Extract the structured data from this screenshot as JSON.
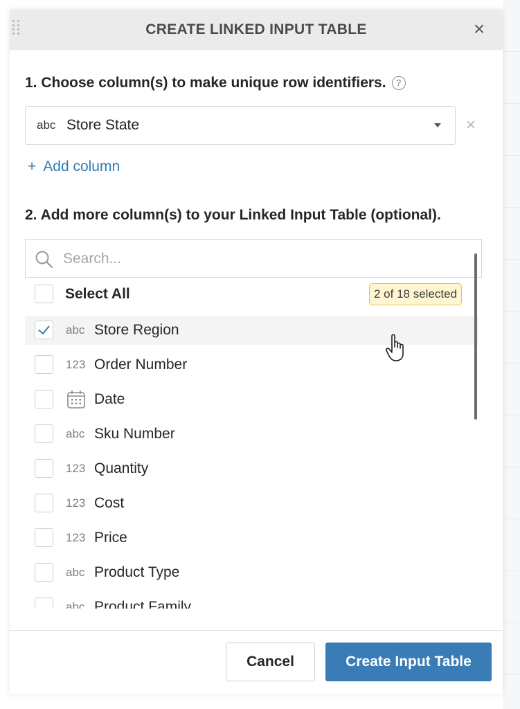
{
  "dialog": {
    "title": "CREATE LINKED INPUT TABLE",
    "close_label": "×"
  },
  "section1": {
    "label": "1. Choose column(s) to make unique row identifiers.",
    "help_label": "?",
    "selected_column": {
      "type": "abc",
      "name": "Store State"
    },
    "remove_label": "×",
    "add_column_plus": "+",
    "add_column_label": "Add column"
  },
  "section2": {
    "label": "2. Add more column(s) to your Linked Input Table (optional).",
    "search_placeholder": "Search...",
    "select_all_label": "Select All",
    "selected_count": "2 of 18 selected",
    "columns": [
      {
        "type": "abc",
        "name": "Store Region",
        "checked": true
      },
      {
        "type": "123",
        "name": "Order Number",
        "checked": false
      },
      {
        "type": "date",
        "name": "Date",
        "checked": false
      },
      {
        "type": "abc",
        "name": "Sku Number",
        "checked": false
      },
      {
        "type": "123",
        "name": "Quantity",
        "checked": false
      },
      {
        "type": "123",
        "name": "Cost",
        "checked": false
      },
      {
        "type": "123",
        "name": "Price",
        "checked": false
      },
      {
        "type": "abc",
        "name": "Product Type",
        "checked": false
      },
      {
        "type": "abc",
        "name": "Product Family",
        "checked": false
      }
    ]
  },
  "footer": {
    "cancel_label": "Cancel",
    "create_label": "Create Input Table"
  },
  "colors": {
    "accent": "#3a7cb5",
    "link": "#2d7bb6",
    "badge_background": "#fff6d1",
    "badge_border": "#e9c24a",
    "header_background": "#ebebeb"
  }
}
